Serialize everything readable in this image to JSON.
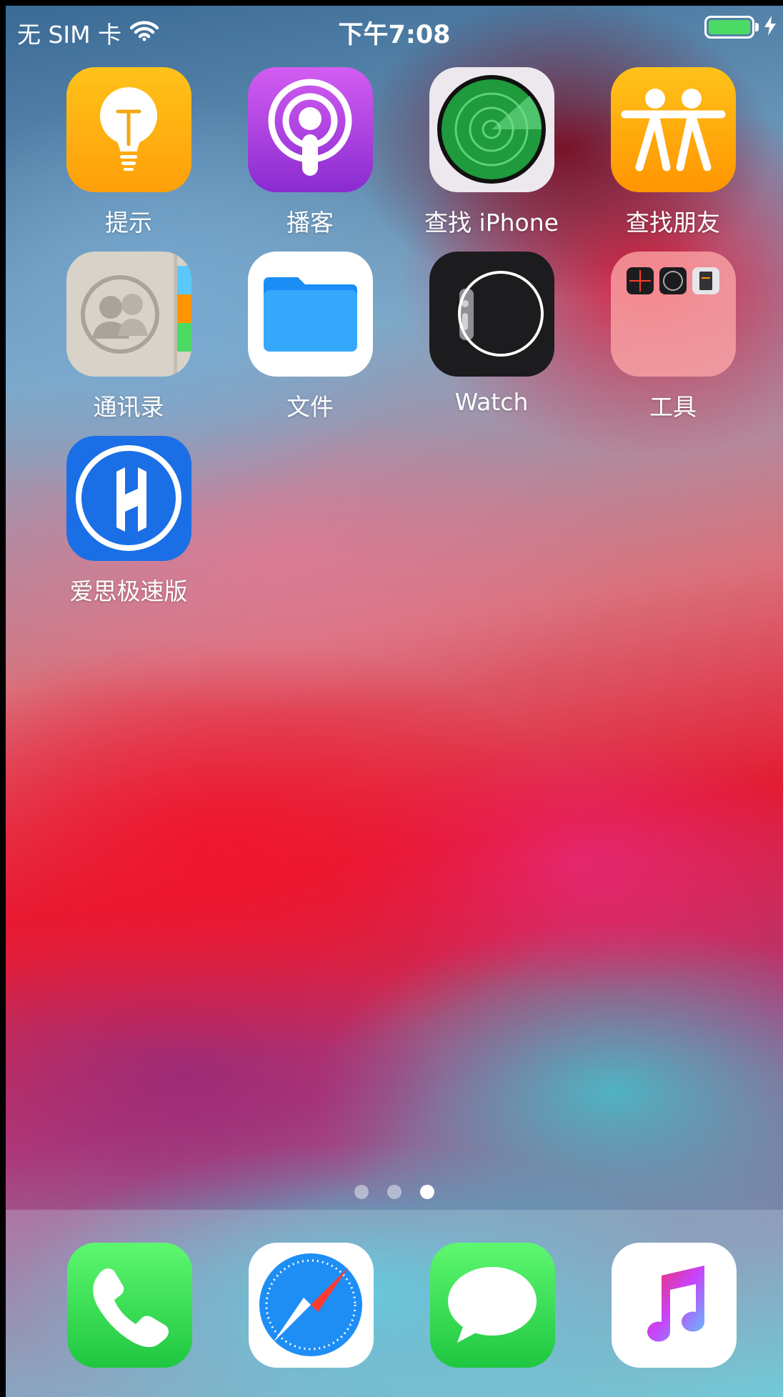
{
  "status_bar": {
    "carrier": "无 SIM 卡",
    "time": "下午7:08",
    "battery_color": "#4cd964"
  },
  "apps": [
    {
      "label": "提示",
      "icon": "lightbulb-icon"
    },
    {
      "label": "播客",
      "icon": "podcasts-icon"
    },
    {
      "label": "查找 iPhone",
      "icon": "radar-icon"
    },
    {
      "label": "查找朋友",
      "icon": "friends-icon"
    },
    {
      "label": "通讯录",
      "icon": "contacts-icon"
    },
    {
      "label": "文件",
      "icon": "folder-icon"
    },
    {
      "label": "Watch",
      "icon": "watch-icon"
    },
    {
      "label": "工具",
      "icon": "utilities-folder-icon"
    },
    {
      "label": "爱思极速版",
      "icon": "i4-icon"
    }
  ],
  "page_indicator": {
    "pages": 3,
    "current": 3
  },
  "dock": [
    {
      "name": "phone",
      "icon": "phone-icon"
    },
    {
      "name": "safari",
      "icon": "compass-icon"
    },
    {
      "name": "messages",
      "icon": "speech-bubble-icon"
    },
    {
      "name": "music",
      "icon": "music-note-icon"
    }
  ]
}
